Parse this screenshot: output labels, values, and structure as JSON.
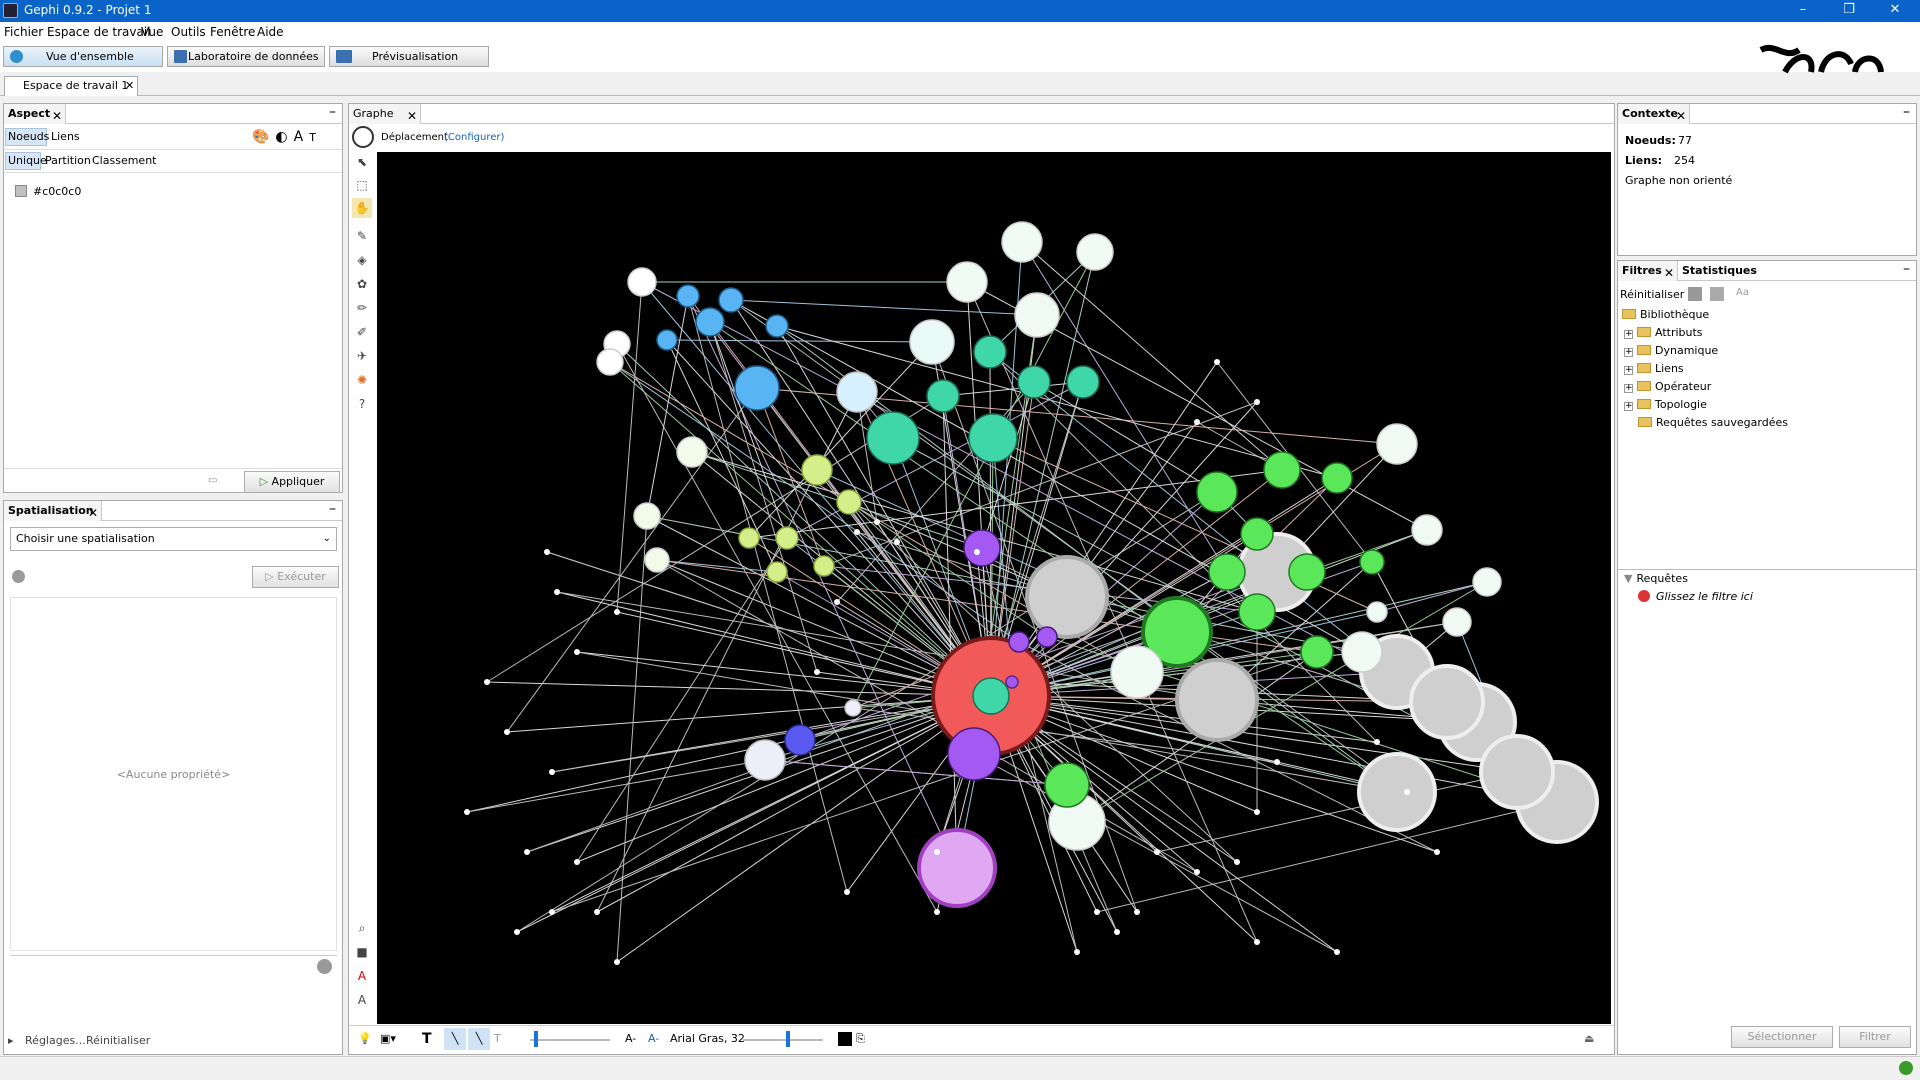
{
  "window": {
    "title": "Gephi 0.9.2 - Projet 1",
    "min": "–",
    "max": "❐",
    "close": "✕"
  },
  "menu": [
    "Fichier",
    "Espace de travail",
    "Vue",
    "Outils",
    "Fenêtre",
    "Aide"
  ],
  "modes": [
    {
      "label": "Vue d'ensemble",
      "icon": "globe-icon",
      "color": "#2f8fd0"
    },
    {
      "label": "Laboratoire de données",
      "icon": "table-icon",
      "color": "#3c6fb0"
    },
    {
      "label": "Prévisualisation",
      "icon": "screen-icon",
      "color": "#3c6fb0"
    }
  ],
  "workspace_tab": "Espace de travail 1",
  "aspect": {
    "title": "Aspect",
    "tabs": [
      "Noeuds",
      "Liens"
    ],
    "subtabs": [
      "Unique",
      "Partition",
      "Classement"
    ],
    "color_value": "#c0c0c0",
    "apply": "Appliquer"
  },
  "spatialisation": {
    "title": "Spatialisation",
    "select": "Choisir une spatialisation",
    "execute": "Exécuter",
    "no_property": "<Aucune propriété>",
    "settings": "Réglages...",
    "reset": "Réinitialiser"
  },
  "graph": {
    "title": "Graphe",
    "mode_label": "Déplacement",
    "configure": "(Configurer)",
    "font_label": "Arial Gras, 32"
  },
  "context": {
    "title": "Contexte",
    "nodes_label": "Noeuds:",
    "nodes_value": "77",
    "edges_label": "Liens:",
    "edges_value": "254",
    "type": "Graphe non orienté"
  },
  "filters": {
    "tab1": "Filtres",
    "tab2": "Statistiques",
    "reset": "Réinitialiser",
    "library": "Bibliothèque",
    "items": [
      "Attributs",
      "Dynamique",
      "Liens",
      "Opérateur",
      "Topologie"
    ],
    "saved": "Requêtes sauvegardées",
    "queries": "Requêtes",
    "drop_here": "Glissez le filtre ici",
    "select": "Sélectionner",
    "filter": "Filtrer"
  }
}
